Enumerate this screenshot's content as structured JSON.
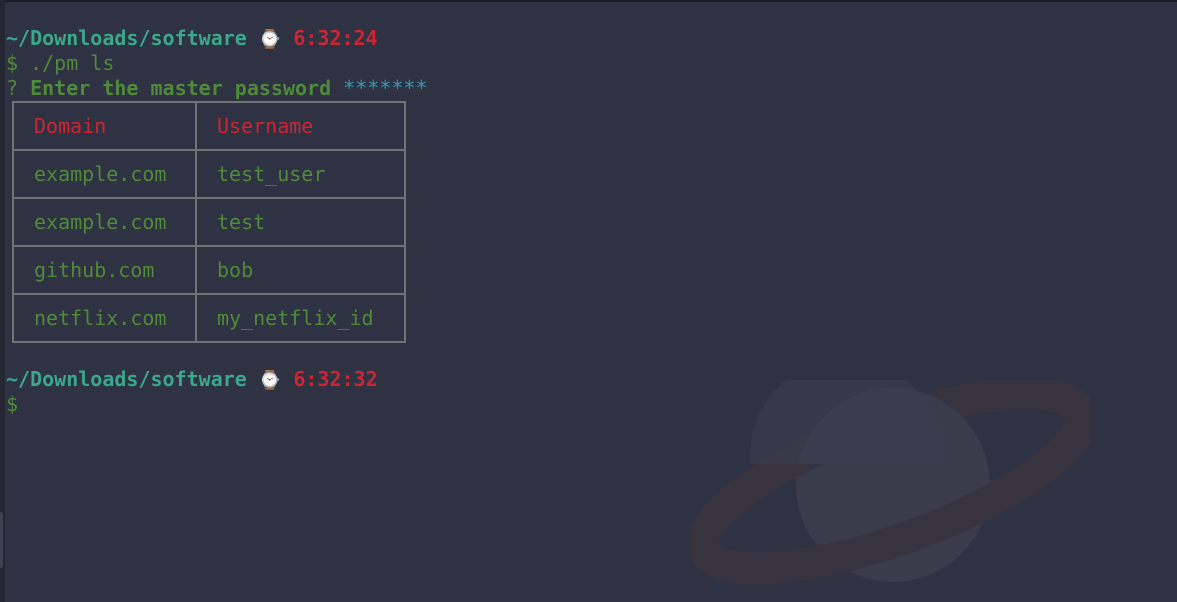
{
  "prompt1": {
    "path": "~/Downloads/software",
    "time": "6:32:24",
    "symbol": "$",
    "command": "./pm ls"
  },
  "question": {
    "marker": "?",
    "text": "Enter the master password",
    "masked": "*******"
  },
  "table": {
    "headers": [
      "Domain",
      "Username"
    ],
    "rows": [
      [
        "example.com",
        "test_user"
      ],
      [
        "example.com",
        "test"
      ],
      [
        "github.com",
        "bob"
      ],
      [
        "netflix.com",
        "my_netflix_id"
      ]
    ]
  },
  "prompt2": {
    "path": "~/Downloads/software",
    "time": "6:32:32",
    "symbol": "$"
  },
  "colors": {
    "background": "#2f3242",
    "path": "#3aa88a",
    "time": "#cf2431",
    "text": "#4f8a3a",
    "masked": "#3398b0",
    "border": "#727272"
  },
  "icons": {
    "clock": "watch-icon",
    "wallpaper": "saturn-planet-icon"
  }
}
